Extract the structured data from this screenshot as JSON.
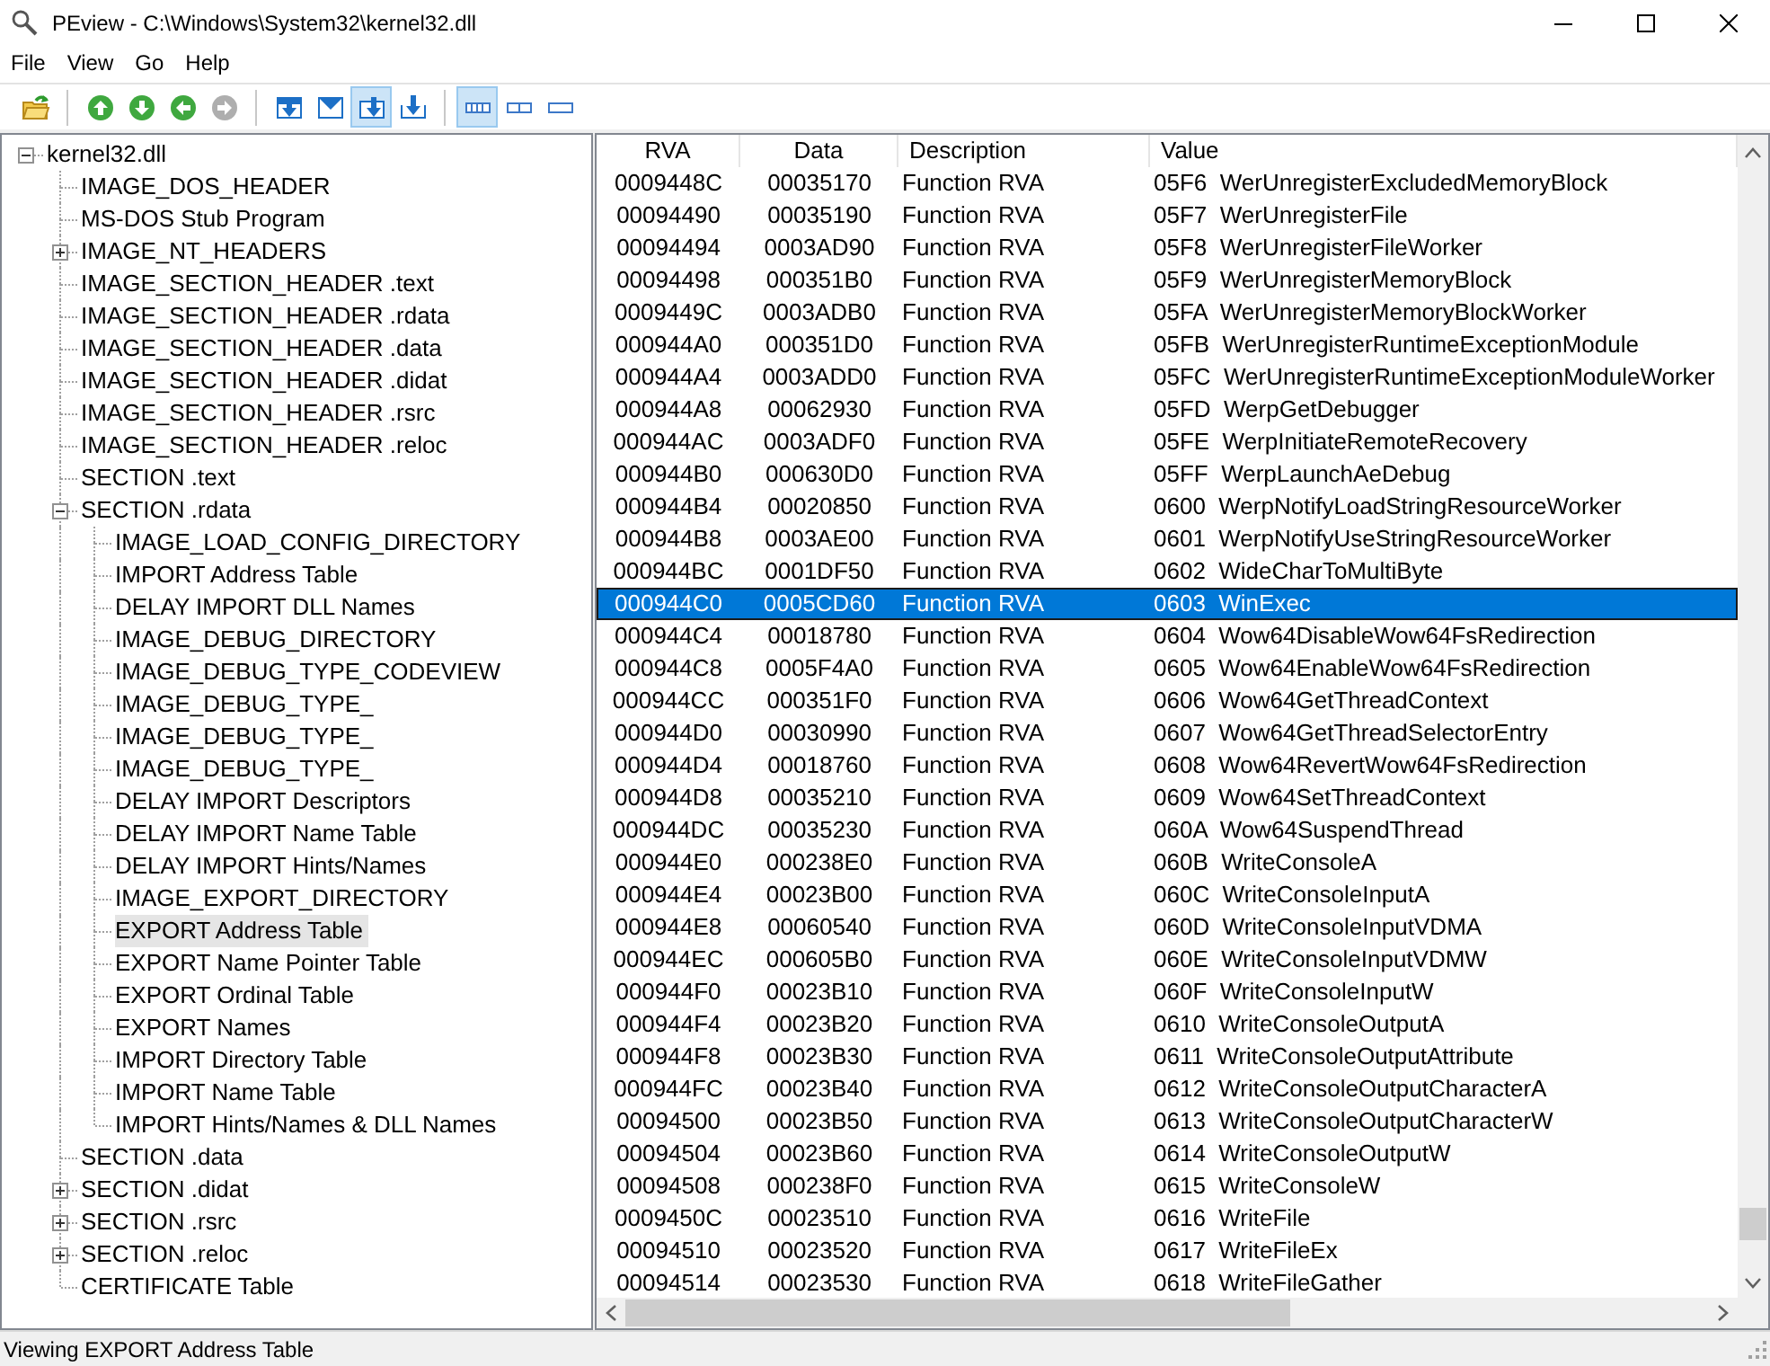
{
  "window": {
    "title": "PEview - C:\\Windows\\System32\\kernel32.dll"
  },
  "menu": [
    "File",
    "View",
    "Go",
    "Help"
  ],
  "toolbar": [
    [
      {
        "kind": "open-folder",
        "pressed": false,
        "disabled": false
      }
    ],
    [
      {
        "kind": "arrow-up",
        "pressed": false,
        "disabled": false
      },
      {
        "kind": "arrow-down",
        "pressed": false,
        "disabled": false
      },
      {
        "kind": "arrow-left",
        "pressed": false,
        "disabled": false
      },
      {
        "kind": "arrow-right",
        "pressed": false,
        "disabled": true
      }
    ],
    [
      {
        "kind": "tray-down",
        "pressed": false,
        "disabled": false
      },
      {
        "kind": "tray-notch",
        "pressed": false,
        "disabled": false
      },
      {
        "kind": "tray-corner",
        "pressed": true,
        "disabled": false
      },
      {
        "kind": "into-tray",
        "pressed": false,
        "disabled": false
      }
    ],
    [
      {
        "kind": "bar-four",
        "pressed": true,
        "disabled": false
      },
      {
        "kind": "bar-two",
        "pressed": false,
        "disabled": false
      },
      {
        "kind": "bar-one",
        "pressed": false,
        "disabled": false
      }
    ]
  ],
  "tree": [
    {
      "label": "kernel32.dll",
      "selected": false,
      "expanded": true,
      "children": [
        {
          "label": "IMAGE_DOS_HEADER",
          "selected": false
        },
        {
          "label": "MS-DOS Stub Program",
          "selected": false
        },
        {
          "label": "IMAGE_NT_HEADERS",
          "selected": false,
          "expanded": false
        },
        {
          "label": "IMAGE_SECTION_HEADER .text",
          "selected": false
        },
        {
          "label": "IMAGE_SECTION_HEADER .rdata",
          "selected": false
        },
        {
          "label": "IMAGE_SECTION_HEADER .data",
          "selected": false
        },
        {
          "label": "IMAGE_SECTION_HEADER .didat",
          "selected": false
        },
        {
          "label": "IMAGE_SECTION_HEADER .rsrc",
          "selected": false
        },
        {
          "label": "IMAGE_SECTION_HEADER .reloc",
          "selected": false
        },
        {
          "label": "SECTION .text",
          "selected": false
        },
        {
          "label": "SECTION .rdata",
          "selected": false,
          "expanded": true,
          "children": [
            {
              "label": "IMAGE_LOAD_CONFIG_DIRECTORY",
              "selected": false
            },
            {
              "label": "IMPORT Address Table",
              "selected": false
            },
            {
              "label": "DELAY IMPORT DLL Names",
              "selected": false
            },
            {
              "label": "IMAGE_DEBUG_DIRECTORY",
              "selected": false
            },
            {
              "label": "IMAGE_DEBUG_TYPE_CODEVIEW",
              "selected": false
            },
            {
              "label": "IMAGE_DEBUG_TYPE_",
              "selected": false
            },
            {
              "label": "IMAGE_DEBUG_TYPE_",
              "selected": false
            },
            {
              "label": "IMAGE_DEBUG_TYPE_",
              "selected": false
            },
            {
              "label": "DELAY IMPORT Descriptors",
              "selected": false
            },
            {
              "label": "DELAY IMPORT Name Table",
              "selected": false
            },
            {
              "label": "DELAY IMPORT Hints/Names",
              "selected": false
            },
            {
              "label": "IMAGE_EXPORT_DIRECTORY",
              "selected": false
            },
            {
              "label": "EXPORT Address Table",
              "selected": true
            },
            {
              "label": "EXPORT Name Pointer Table",
              "selected": false
            },
            {
              "label": "EXPORT Ordinal Table",
              "selected": false
            },
            {
              "label": "EXPORT Names",
              "selected": false
            },
            {
              "label": "IMPORT Directory Table",
              "selected": false
            },
            {
              "label": "IMPORT Name Table",
              "selected": false
            },
            {
              "label": "IMPORT Hints/Names & DLL Names",
              "selected": false
            }
          ]
        },
        {
          "label": "SECTION .data",
          "selected": false
        },
        {
          "label": "SECTION .didat",
          "selected": false,
          "expanded": false
        },
        {
          "label": "SECTION .rsrc",
          "selected": false,
          "expanded": false
        },
        {
          "label": "SECTION .reloc",
          "selected": false,
          "expanded": false
        },
        {
          "label": "CERTIFICATE Table",
          "selected": false
        }
      ]
    }
  ],
  "table": {
    "columns": [
      "RVA",
      "Data",
      "Description",
      "Value"
    ],
    "rows": [
      {
        "rva": "0009448C",
        "data": "00035170",
        "description": "Function RVA",
        "value": "05F6  WerUnregisterExcludedMemoryBlock",
        "selected": false
      },
      {
        "rva": "00094490",
        "data": "00035190",
        "description": "Function RVA",
        "value": "05F7  WerUnregisterFile",
        "selected": false
      },
      {
        "rva": "00094494",
        "data": "0003AD90",
        "description": "Function RVA",
        "value": "05F8  WerUnregisterFileWorker",
        "selected": false
      },
      {
        "rva": "00094498",
        "data": "000351B0",
        "description": "Function RVA",
        "value": "05F9  WerUnregisterMemoryBlock",
        "selected": false
      },
      {
        "rva": "0009449C",
        "data": "0003ADB0",
        "description": "Function RVA",
        "value": "05FA  WerUnregisterMemoryBlockWorker",
        "selected": false
      },
      {
        "rva": "000944A0",
        "data": "000351D0",
        "description": "Function RVA",
        "value": "05FB  WerUnregisterRuntimeExceptionModule",
        "selected": false
      },
      {
        "rva": "000944A4",
        "data": "0003ADD0",
        "description": "Function RVA",
        "value": "05FC  WerUnregisterRuntimeExceptionModuleWorker",
        "selected": false
      },
      {
        "rva": "000944A8",
        "data": "00062930",
        "description": "Function RVA",
        "value": "05FD  WerpGetDebugger",
        "selected": false
      },
      {
        "rva": "000944AC",
        "data": "0003ADF0",
        "description": "Function RVA",
        "value": "05FE  WerpInitiateRemoteRecovery",
        "selected": false
      },
      {
        "rva": "000944B0",
        "data": "000630D0",
        "description": "Function RVA",
        "value": "05FF  WerpLaunchAeDebug",
        "selected": false
      },
      {
        "rva": "000944B4",
        "data": "00020850",
        "description": "Function RVA",
        "value": "0600  WerpNotifyLoadStringResourceWorker",
        "selected": false
      },
      {
        "rva": "000944B8",
        "data": "0003AE00",
        "description": "Function RVA",
        "value": "0601  WerpNotifyUseStringResourceWorker",
        "selected": false
      },
      {
        "rva": "000944BC",
        "data": "0001DF50",
        "description": "Function RVA",
        "value": "0602  WideCharToMultiByte",
        "selected": false
      },
      {
        "rva": "000944C0",
        "data": "0005CD60",
        "description": "Function RVA",
        "value": "0603  WinExec",
        "selected": true
      },
      {
        "rva": "000944C4",
        "data": "00018780",
        "description": "Function RVA",
        "value": "0604  Wow64DisableWow64FsRedirection",
        "selected": false
      },
      {
        "rva": "000944C8",
        "data": "0005F4A0",
        "description": "Function RVA",
        "value": "0605  Wow64EnableWow64FsRedirection",
        "selected": false
      },
      {
        "rva": "000944CC",
        "data": "000351F0",
        "description": "Function RVA",
        "value": "0606  Wow64GetThreadContext",
        "selected": false
      },
      {
        "rva": "000944D0",
        "data": "00030990",
        "description": "Function RVA",
        "value": "0607  Wow64GetThreadSelectorEntry",
        "selected": false
      },
      {
        "rva": "000944D4",
        "data": "00018760",
        "description": "Function RVA",
        "value": "0608  Wow64RevertWow64FsRedirection",
        "selected": false
      },
      {
        "rva": "000944D8",
        "data": "00035210",
        "description": "Function RVA",
        "value": "0609  Wow64SetThreadContext",
        "selected": false
      },
      {
        "rva": "000944DC",
        "data": "00035230",
        "description": "Function RVA",
        "value": "060A  Wow64SuspendThread",
        "selected": false
      },
      {
        "rva": "000944E0",
        "data": "000238E0",
        "description": "Function RVA",
        "value": "060B  WriteConsoleA",
        "selected": false
      },
      {
        "rva": "000944E4",
        "data": "00023B00",
        "description": "Function RVA",
        "value": "060C  WriteConsoleInputA",
        "selected": false
      },
      {
        "rva": "000944E8",
        "data": "00060540",
        "description": "Function RVA",
        "value": "060D  WriteConsoleInputVDMA",
        "selected": false
      },
      {
        "rva": "000944EC",
        "data": "000605B0",
        "description": "Function RVA",
        "value": "060E  WriteConsoleInputVDMW",
        "selected": false
      },
      {
        "rva": "000944F0",
        "data": "00023B10",
        "description": "Function RVA",
        "value": "060F  WriteConsoleInputW",
        "selected": false
      },
      {
        "rva": "000944F4",
        "data": "00023B20",
        "description": "Function RVA",
        "value": "0610  WriteConsoleOutputA",
        "selected": false
      },
      {
        "rva": "000944F8",
        "data": "00023B30",
        "description": "Function RVA",
        "value": "0611  WriteConsoleOutputAttribute",
        "selected": false
      },
      {
        "rva": "000944FC",
        "data": "00023B40",
        "description": "Function RVA",
        "value": "0612  WriteConsoleOutputCharacterA",
        "selected": false
      },
      {
        "rva": "00094500",
        "data": "00023B50",
        "description": "Function RVA",
        "value": "0613  WriteConsoleOutputCharacterW",
        "selected": false
      },
      {
        "rva": "00094504",
        "data": "00023B60",
        "description": "Function RVA",
        "value": "0614  WriteConsoleOutputW",
        "selected": false
      },
      {
        "rva": "00094508",
        "data": "000238F0",
        "description": "Function RVA",
        "value": "0615  WriteConsoleW",
        "selected": false
      },
      {
        "rva": "0009450C",
        "data": "00023510",
        "description": "Function RVA",
        "value": "0616  WriteFile",
        "selected": false
      },
      {
        "rva": "00094510",
        "data": "00023520",
        "description": "Function RVA",
        "value": "0617  WriteFileEx",
        "selected": false
      },
      {
        "rva": "00094514",
        "data": "00023530",
        "description": "Function RVA",
        "value": "0618  WriteFileGather",
        "selected": false
      }
    ]
  },
  "status_bar": "Viewing EXPORT Address Table"
}
